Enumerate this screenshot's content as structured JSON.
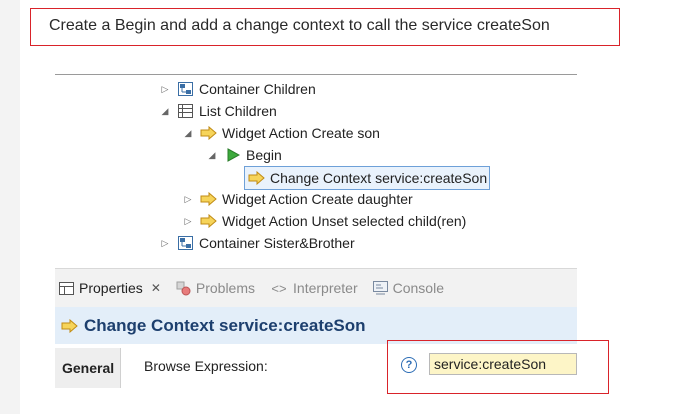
{
  "instruction": "Create a Begin and add a change context to call the service createSon",
  "tree": {
    "items": [
      {
        "label": "Container Children",
        "expander": "▷",
        "icon": "container-icon"
      },
      {
        "label": "List Children",
        "expander": "◢",
        "icon": "list-icon"
      },
      {
        "label": "Widget Action Create son",
        "expander": "◢",
        "icon": "action-arrow-icon"
      },
      {
        "label": "Begin",
        "expander": "◢",
        "icon": "begin-play-icon"
      },
      {
        "label": "Change Context service:createSon",
        "expander": "",
        "icon": "action-arrow-icon",
        "selected": true
      },
      {
        "label": "Widget Action Create daughter",
        "expander": "▷",
        "icon": "action-arrow-icon"
      },
      {
        "label": "Widget Action Unset selected child(ren)",
        "expander": "▷",
        "icon": "action-arrow-icon"
      },
      {
        "label": "Container Sister&Brother",
        "expander": "▷",
        "icon": "container-icon"
      }
    ]
  },
  "tabs": [
    {
      "label": "Properties",
      "active": true,
      "close": "✕"
    },
    {
      "label": "Problems",
      "active": false
    },
    {
      "label": "Interpreter",
      "active": false
    },
    {
      "label": "Console",
      "active": false
    }
  ],
  "properties": {
    "title": "Change Context service:createSon",
    "section_tab": "General",
    "browse_label": "Browse Expression:",
    "help_glyph": "?",
    "browse_value": "service:createSon"
  },
  "colors": {
    "highlight_border": "#d9232a",
    "selection_bg": "#e9f2fc",
    "input_bg": "#fdf5c7",
    "title_bg": "#e3eef9"
  }
}
